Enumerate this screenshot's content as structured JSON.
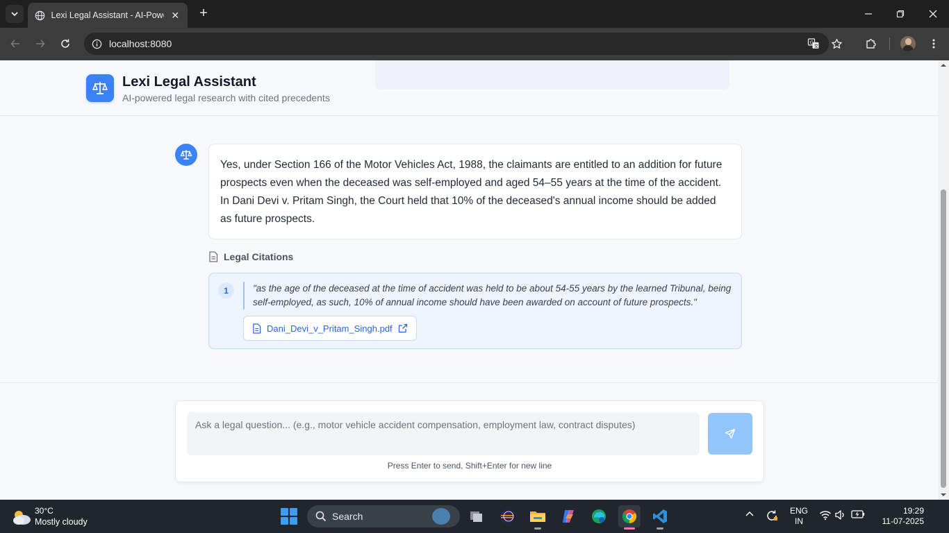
{
  "browser": {
    "tab_title": "Lexi Legal Assistant - AI-Powered",
    "url": "localhost:8080"
  },
  "app": {
    "title": "Lexi Legal Assistant",
    "subtitle": "AI-powered legal research with cited precedents",
    "accent_color": "#3b82f6"
  },
  "conversation": {
    "answer": "Yes, under Section 166 of the Motor Vehicles Act, 1988, the claimants are entitled to an addition for future prospects even when the deceased was self-employed and aged 54–55 years at the time of the accident. In Dani Devi v. Pritam Singh, the Court held that 10% of the deceased's annual income should be added as future prospects.",
    "citations_label": "Legal Citations",
    "citations": [
      {
        "number": "1",
        "quote": "\"as the age of the deceased at the time of accident was held to be about 54-55 years by the learned Tribunal, being self-employed, as such, 10% of annual income should have been awarded on account of future prospects.\"",
        "file": "Dani_Devi_v_Pritam_Singh.pdf"
      }
    ]
  },
  "composer": {
    "placeholder": "Ask a legal question... (e.g., motor vehicle accident compensation, employment law, contract disputes)",
    "value": "",
    "hint": "Press Enter to send, Shift+Enter for new line"
  },
  "taskbar": {
    "weather_temp": "30°C",
    "weather_desc": "Mostly cloudy",
    "search_label": "Search",
    "lang_line1": "ENG",
    "lang_line2": "IN",
    "time": "19:29",
    "date": "11-07-2025"
  }
}
